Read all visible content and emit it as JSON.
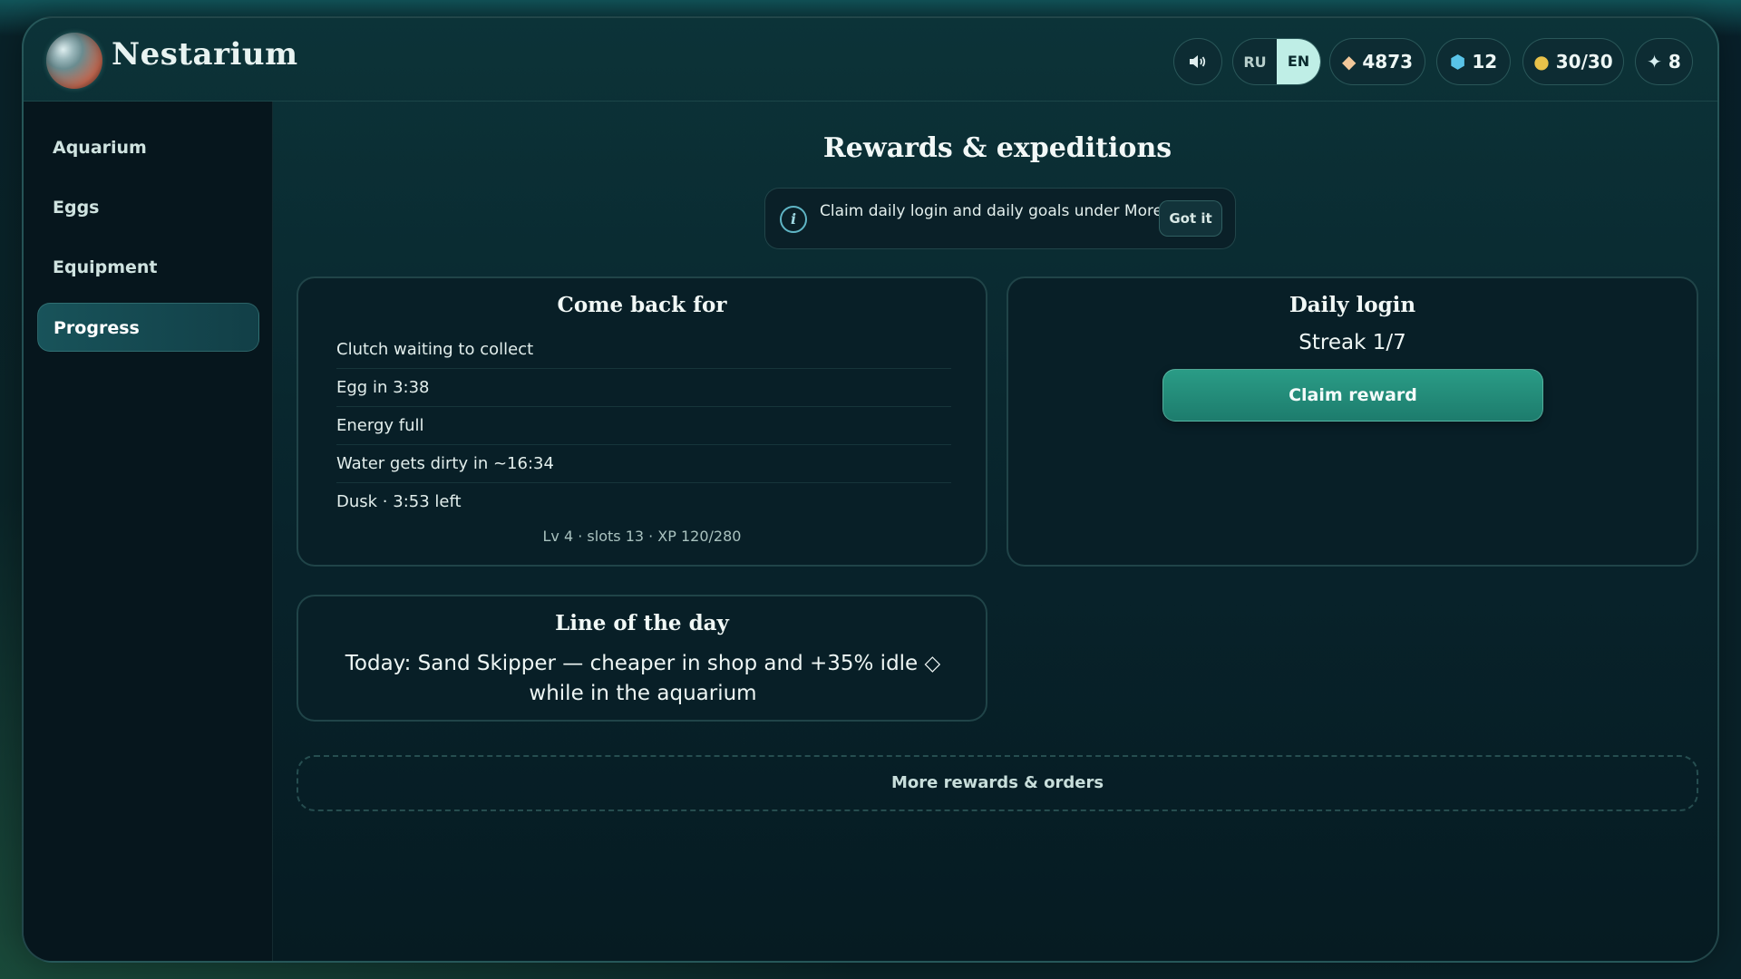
{
  "app": {
    "title": "Nestarium"
  },
  "header": {
    "lang_ru": "RU",
    "lang_en": "EN",
    "resources": [
      {
        "icon": "diamond-icon",
        "value": "4873"
      },
      {
        "icon": "cube-icon",
        "value": "12"
      },
      {
        "icon": "coin-icon",
        "value": "30/30"
      },
      {
        "icon": "star-icon",
        "value": "8"
      }
    ]
  },
  "sidebar": {
    "items": [
      {
        "label": "Aquarium"
      },
      {
        "label": "Eggs"
      },
      {
        "label": "Equipment"
      },
      {
        "label": "Progress",
        "active": true
      }
    ]
  },
  "main": {
    "title": "Rewards & expeditions",
    "tip": {
      "text": "Claim daily login and daily goals under More.",
      "button": "Got it"
    },
    "come_back": {
      "title": "Come back for",
      "items": [
        "Clutch waiting to collect",
        "Egg in 3:38",
        "Energy full",
        "Water gets dirty in ~16:34",
        "Dusk · 3:53 left"
      ],
      "meta": "Lv 4 · slots 13 · XP 120/280"
    },
    "daily_login": {
      "title": "Daily login",
      "streak": "Streak 1/7",
      "button": "Claim reward"
    },
    "line_of_day": {
      "title": "Line of the day",
      "text": "Today: Sand Skipper — cheaper in shop and +35% idle ◇ while in the aquarium"
    },
    "more_button": "More rewards & orders"
  }
}
